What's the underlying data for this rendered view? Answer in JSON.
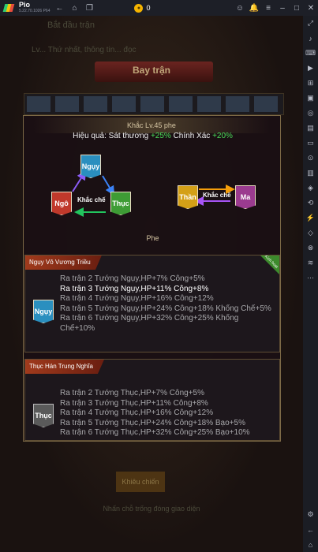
{
  "titlebar": {
    "app_name": "Pio",
    "version": "5.22.70.1026 P64",
    "coins": "0"
  },
  "background": {
    "text_top": "Bắt đầu trận",
    "text_sub": "Lv... Thứ nhất, thông tin... đọc",
    "title": "Bay trận",
    "bottom_button": "Khiêu chiến",
    "bottom_text": "Nhấn chỗ trống đóng giao diện"
  },
  "modal": {
    "header": "Khắc Lv.45 phe",
    "effect": {
      "label": "Hiệu quả: Sát thương",
      "dmg_bonus": "+25%",
      "acc_label": "Chính Xác",
      "acc_bonus": "+20%"
    },
    "diagram": {
      "left_banners": [
        {
          "label": "Ngụy",
          "color": "#2a8fbf"
        },
        {
          "label": "Ngô",
          "color": "#c0392b"
        },
        {
          "label": "Thục",
          "color": "#3e9c35"
        }
      ],
      "left_label": "Khắc chế",
      "right_banners": [
        {
          "label": "Thần",
          "color": "#d4a017"
        },
        {
          "label": "Ma",
          "color": "#9b3b8f"
        }
      ],
      "right_label": "Khắc chế"
    },
    "phe_label": "Phe",
    "cards": [
      {
        "title": "Ngụy Vô Vương Triều",
        "badge": "Kích hoạt",
        "icon": {
          "label": "Ngụy",
          "color": "#2a8fbf"
        },
        "lines": [
          "Ra trận 2 Tướng Ngụy,HP+7% Công+5%",
          "Ra trận 3 Tướng Ngụy,HP+11% Công+8%",
          "Ra trận 4 Tướng Ngụy,HP+16% Công+12%",
          "Ra trận 5 Tướng Ngụy,HP+24% Công+18% Khống Chế+5%",
          "Ra trận 6 Tướng Ngụy,HP+32% Công+25% Khống Chế+10%"
        ],
        "active_index": 1
      },
      {
        "title": "Thục Hán Trung Nghĩa",
        "badge": "",
        "icon": {
          "label": "Thục",
          "color": "#5a5a5a"
        },
        "lines": [
          "Ra trận 2 Tướng Thục,HP+7% Công+5%",
          "Ra trận 3 Tướng Thục,HP+11% Công+8%",
          "Ra trận 4 Tướng Thục,HP+16% Công+12%",
          "Ra trận 5 Tướng Thục,HP+24% Công+18% Bạo+5%",
          "Ra trận 6 Tướng Thục,HP+32% Công+25% Bạo+10%"
        ],
        "active_index": -1
      }
    ]
  }
}
